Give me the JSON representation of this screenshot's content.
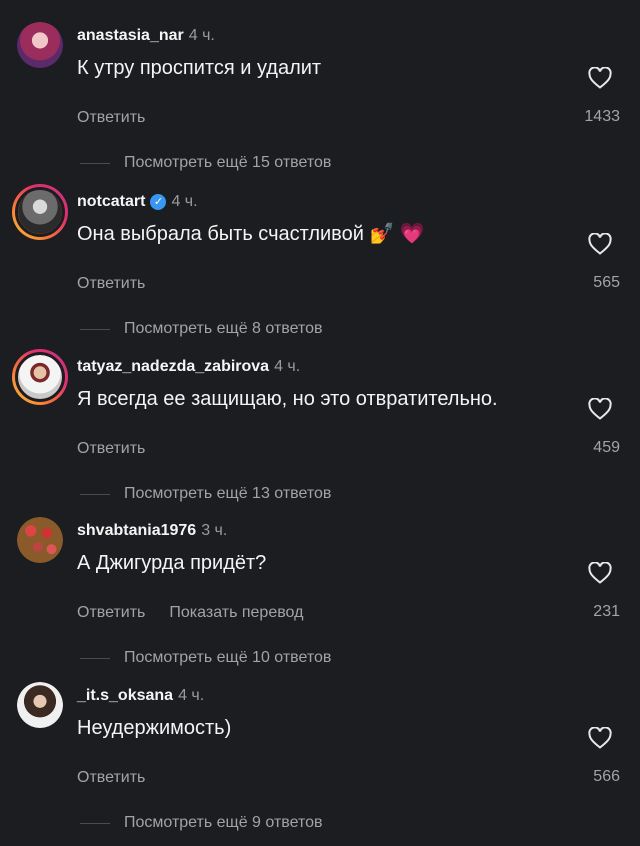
{
  "comments": [
    {
      "username": "anastasia_nar",
      "time": "4 ч.",
      "text": "К утру проспится и удалит",
      "reply": "Ответить",
      "likes": "1433",
      "more": "Посмотреть ещё 15 ответов",
      "avatar": "woman-pink-hair-avatar"
    },
    {
      "username": "notcatart",
      "verified": true,
      "time": "4 ч.",
      "text": "Она выбрала быть счастливой",
      "emoji1": "💅",
      "emoji2": "💗",
      "reply": "Ответить",
      "likes": "565",
      "more": "Посмотреть ещё 8 ответов",
      "avatar": "man-grey-hair-avatar"
    },
    {
      "username": "tatyaz_nadezda_zabirova",
      "time": "4 ч.",
      "text": "Я всегда ее защищаю, но это отвратительно.",
      "reply": "Ответить",
      "likes": "459",
      "more": "Посмотреть ещё 13 ответов",
      "avatar": "woman-white-dress-avatar"
    },
    {
      "username": "shvabtania1976",
      "time": "3 ч.",
      "text": "А Джигурда придёт?",
      "reply": "Ответить",
      "translate": "Показать перевод",
      "likes": "231",
      "more": "Посмотреть ещё 10 ответов",
      "avatar": "strawberries-avatar"
    },
    {
      "username": "_it.s_oksana",
      "time": "4 ч.",
      "text": "Неудержимость)",
      "reply": "Ответить",
      "likes": "566",
      "more": "Посмотреть ещё 9 ответов",
      "avatar": "woman-dark-hair-avatar"
    }
  ],
  "colors": {
    "background": "#1c1d21",
    "secondary_text": "#a3a3a7",
    "verified": "#3897f0"
  }
}
